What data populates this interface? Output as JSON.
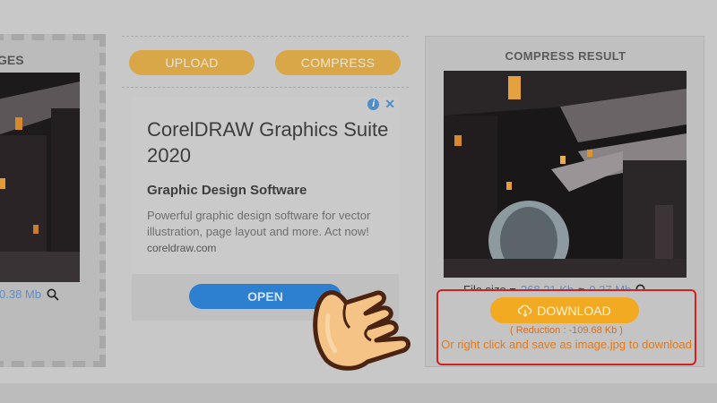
{
  "left_panel": {
    "title": "GES",
    "file_size": "0.38 Mb"
  },
  "toolbar": {
    "upload_label": "UPLOAD",
    "compress_label": "COMPRESS"
  },
  "ad": {
    "title": "CorelDRAW Graphics Suite 2020",
    "subtitle": "Graphic Design Software",
    "description": "Powerful graphic design software for vector illustration, page layout and more. Act now!",
    "domain": "coreldraw.com",
    "cta_label": "OPEN",
    "info_icon": "i",
    "close_icon": "✕"
  },
  "result": {
    "title": "COMPRESS RESULT",
    "file_size_label": "File size = ",
    "original_size": "268.21 Kb",
    "arrow": "≈",
    "compressed_size": "0.27 Mb",
    "download_label": "DOWNLOAD",
    "reduction": "( Reduction : -109.68 Kb )",
    "hint": "Or right click and save as image.jpg to download"
  },
  "colors": {
    "accent_gold": "#d9a748",
    "download_orange": "#f2aa22",
    "link_blue": "#5f8ec4",
    "highlight_red": "#d02020"
  }
}
